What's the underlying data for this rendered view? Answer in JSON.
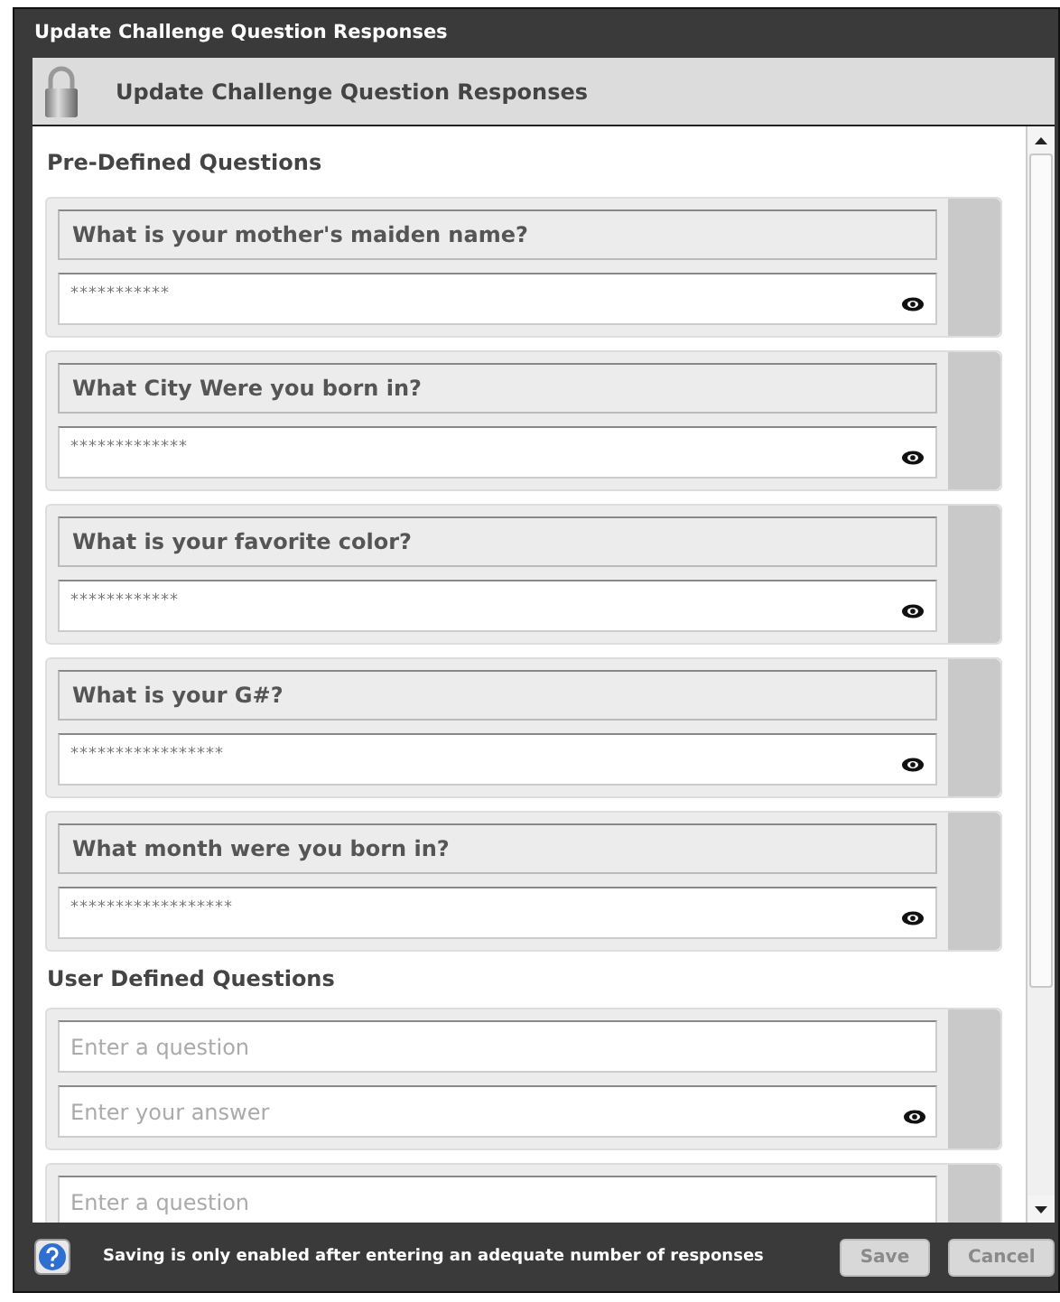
{
  "window": {
    "title": "Update Challenge Question Responses"
  },
  "header": {
    "title": "Update Challenge Question Responses"
  },
  "sections": [
    {
      "title": "Pre-Defined Questions",
      "items": [
        {
          "kind": "predefined",
          "question": "What is your mother's maiden name?",
          "answer": "***********"
        },
        {
          "kind": "predefined",
          "question": "What City Were you born in?",
          "answer": "*************"
        },
        {
          "kind": "predefined",
          "question": "What is your favorite color?",
          "answer": "************"
        },
        {
          "kind": "predefined",
          "question": "What is your G#?",
          "answer": "*****************"
        },
        {
          "kind": "predefined",
          "question": "What month were you born in?",
          "answer": "******************"
        }
      ]
    },
    {
      "title": "User Defined Questions",
      "items": [
        {
          "kind": "custom",
          "question_placeholder": "Enter a question",
          "answer_placeholder": "Enter your answer"
        },
        {
          "kind": "custom",
          "question_placeholder": "Enter a question"
        }
      ]
    }
  ],
  "footer": {
    "message": "Saving is only enabled after entering an adequate number of responses",
    "buttons": [
      {
        "label": "Save",
        "disabled": true
      },
      {
        "label": "Cancel",
        "disabled": true
      }
    ]
  }
}
